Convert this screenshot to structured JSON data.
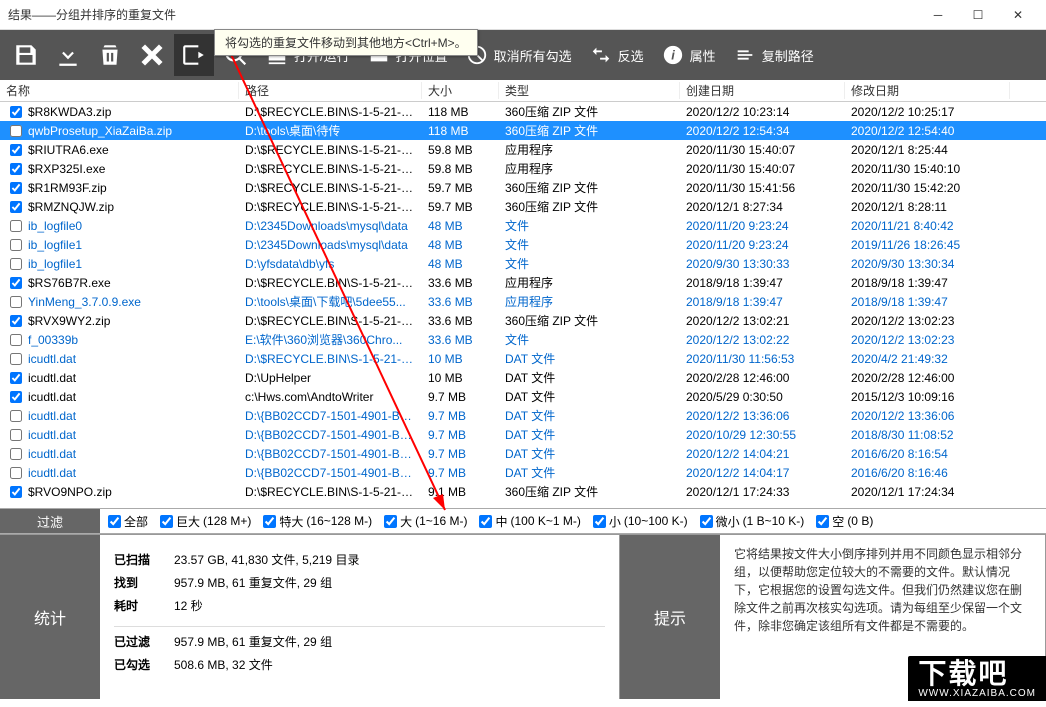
{
  "window": {
    "title": "结果——分组并排序的重复文件"
  },
  "tooltip": {
    "text": "将勾选的重复文件移动到其他地方<Ctrl+M>。"
  },
  "toolbar": {
    "save_icon": "save-icon",
    "download_icon": "download-icon",
    "recycle_icon": "recycle-icon",
    "delete_icon": "close-icon",
    "move_icon": "move-icon",
    "search_icon": "search-icon",
    "open_run": "打开/运行",
    "open_location": "打开位置",
    "uncheck_all": "取消所有勾选",
    "invert": "反选",
    "properties": "属性",
    "copy_path": "复制路径"
  },
  "columns": {
    "name": "名称",
    "path": "路径",
    "size": "大小",
    "type": "类型",
    "cdate": "创建日期",
    "mdate": "修改日期"
  },
  "rows": [
    {
      "chk": true,
      "name": "$R8KWDA3.zip",
      "path": "D:\\$RECYCLE.BIN\\S-1-5-21-21...",
      "size": "118 MB",
      "type": "360压缩 ZIP 文件",
      "cdate": "2020/12/2 10:23:14",
      "mdate": "2020/12/2 10:25:17",
      "link": false,
      "sel": false
    },
    {
      "chk": false,
      "name": "qwbProsetup_XiaZaiBa.zip",
      "path": "D:\\tools\\桌面\\待传",
      "size": "118 MB",
      "type": "360压缩 ZIP 文件",
      "cdate": "2020/12/2 12:54:34",
      "mdate": "2020/12/2 12:54:40",
      "link": false,
      "sel": true
    },
    {
      "chk": true,
      "name": "$RIUTRA6.exe",
      "path": "D:\\$RECYCLE.BIN\\S-1-5-21-21...",
      "size": "59.8 MB",
      "type": "应用程序",
      "cdate": "2020/11/30 15:40:07",
      "mdate": "2020/12/1 8:25:44",
      "link": false,
      "sel": false
    },
    {
      "chk": true,
      "name": "$RXP325I.exe",
      "path": "D:\\$RECYCLE.BIN\\S-1-5-21-21...",
      "size": "59.8 MB",
      "type": "应用程序",
      "cdate": "2020/11/30 15:40:07",
      "mdate": "2020/11/30 15:40:10",
      "link": false,
      "sel": false
    },
    {
      "chk": true,
      "name": "$R1RM93F.zip",
      "path": "D:\\$RECYCLE.BIN\\S-1-5-21-21...",
      "size": "59.7 MB",
      "type": "360压缩 ZIP 文件",
      "cdate": "2020/11/30 15:41:56",
      "mdate": "2020/11/30 15:42:20",
      "link": false,
      "sel": false
    },
    {
      "chk": true,
      "name": "$RMZNQJW.zip",
      "path": "D:\\$RECYCLE.BIN\\S-1-5-21-21...",
      "size": "59.7 MB",
      "type": "360压缩 ZIP 文件",
      "cdate": "2020/12/1 8:27:34",
      "mdate": "2020/12/1 8:28:11",
      "link": false,
      "sel": false
    },
    {
      "chk": false,
      "name": "ib_logfile0",
      "path": "D:\\2345Downloads\\mysql\\data",
      "size": "48 MB",
      "type": "文件",
      "cdate": "2020/11/20 9:23:24",
      "mdate": "2020/11/21 8:40:42",
      "link": true,
      "sel": false
    },
    {
      "chk": false,
      "name": "ib_logfile1",
      "path": "D:\\2345Downloads\\mysql\\data",
      "size": "48 MB",
      "type": "文件",
      "cdate": "2020/11/20 9:23:24",
      "mdate": "2019/11/26 18:26:45",
      "link": true,
      "sel": false
    },
    {
      "chk": false,
      "name": "ib_logfile1",
      "path": "D:\\yfsdata\\db\\yfs",
      "size": "48 MB",
      "type": "文件",
      "cdate": "2020/9/30 13:30:33",
      "mdate": "2020/9/30 13:30:34",
      "link": true,
      "sel": false
    },
    {
      "chk": true,
      "name": "$RS76B7R.exe",
      "path": "D:\\$RECYCLE.BIN\\S-1-5-21-21...",
      "size": "33.6 MB",
      "type": "应用程序",
      "cdate": "2018/9/18 1:39:47",
      "mdate": "2018/9/18 1:39:47",
      "link": false,
      "sel": false
    },
    {
      "chk": false,
      "name": "YinMeng_3.7.0.9.exe",
      "path": "D:\\tools\\桌面\\下载吧\\5dee55...",
      "size": "33.6 MB",
      "type": "应用程序",
      "cdate": "2018/9/18 1:39:47",
      "mdate": "2018/9/18 1:39:47",
      "link": true,
      "sel": false
    },
    {
      "chk": true,
      "name": "$RVX9WY2.zip",
      "path": "D:\\$RECYCLE.BIN\\S-1-5-21-21...",
      "size": "33.6 MB",
      "type": "360压缩 ZIP 文件",
      "cdate": "2020/12/2 13:02:21",
      "mdate": "2020/12/2 13:02:23",
      "link": false,
      "sel": false
    },
    {
      "chk": false,
      "name": "f_00339b",
      "path": "E:\\软件\\360浏览器\\360Chro...",
      "size": "33.6 MB",
      "type": "文件",
      "cdate": "2020/12/2 13:02:22",
      "mdate": "2020/12/2 13:02:23",
      "link": true,
      "sel": false
    },
    {
      "chk": false,
      "name": "icudtl.dat",
      "path": "D:\\$RECYCLE.BIN\\S-1-5-21-21...",
      "size": "10 MB",
      "type": "DAT 文件",
      "cdate": "2020/11/30 11:56:53",
      "mdate": "2020/4/2 21:49:32",
      "link": true,
      "sel": false
    },
    {
      "chk": true,
      "name": "icudtl.dat",
      "path": "D:\\UpHelper",
      "size": "10 MB",
      "type": "DAT 文件",
      "cdate": "2020/2/28 12:46:00",
      "mdate": "2020/2/28 12:46:00",
      "link": false,
      "sel": false
    },
    {
      "chk": true,
      "name": "icudtl.dat",
      "path": "c:\\Hws.com\\AndtoWriter",
      "size": "9.7 MB",
      "type": "DAT 文件",
      "cdate": "2020/5/29 0:30:50",
      "mdate": "2015/12/3 10:09:16",
      "link": false,
      "sel": false
    },
    {
      "chk": false,
      "name": "icudtl.dat",
      "path": "D:\\{BB02CCD7-1501-4901-B5E...",
      "size": "9.7 MB",
      "type": "DAT 文件",
      "cdate": "2020/12/2 13:36:06",
      "mdate": "2020/12/2 13:36:06",
      "link": true,
      "sel": false
    },
    {
      "chk": false,
      "name": "icudtl.dat",
      "path": "D:\\{BB02CCD7-1501-4901-B5E...",
      "size": "9.7 MB",
      "type": "DAT 文件",
      "cdate": "2020/10/29 12:30:55",
      "mdate": "2018/8/30 11:08:52",
      "link": true,
      "sel": false
    },
    {
      "chk": false,
      "name": "icudtl.dat",
      "path": "D:\\{BB02CCD7-1501-4901-B5E...",
      "size": "9.7 MB",
      "type": "DAT 文件",
      "cdate": "2020/12/2 14:04:21",
      "mdate": "2016/6/20 8:16:54",
      "link": true,
      "sel": false
    },
    {
      "chk": false,
      "name": "icudtl.dat",
      "path": "D:\\{BB02CCD7-1501-4901-B5E...",
      "size": "9.7 MB",
      "type": "DAT 文件",
      "cdate": "2020/12/2 14:04:17",
      "mdate": "2016/6/20 8:16:46",
      "link": true,
      "sel": false
    },
    {
      "chk": true,
      "name": "$RVO9NPO.zip",
      "path": "D:\\$RECYCLE.BIN\\S-1-5-21-21...",
      "size": "9.1 MB",
      "type": "360压缩 ZIP 文件",
      "cdate": "2020/12/1 17:24:33",
      "mdate": "2020/12/1 17:24:34",
      "link": false,
      "sel": false
    }
  ],
  "filter": {
    "label": "过滤",
    "all": "全部",
    "huge": "巨大",
    "huge_r": "(128 M+)",
    "large": "特大",
    "large_r": "(16~128 M-)",
    "big": "大",
    "big_r": "(1~16 M-)",
    "med": "中",
    "med_r": "(100 K~1 M-)",
    "small": "小",
    "small_r": "(10~100 K-)",
    "tiny": "微小",
    "tiny_r": "(1 B~10 K-)",
    "empty": "空",
    "empty_r": "(0 B)"
  },
  "stats": {
    "label": "统计",
    "scanned_k": "已扫描",
    "scanned_v": "23.57 GB, 41,830 文件, 5,219 目录",
    "found_k": "找到",
    "found_v": "957.9 MB, 61 重复文件, 29 组",
    "time_k": "耗时",
    "time_v": "12 秒",
    "filtered_k": "已过滤",
    "filtered_v": "957.9 MB, 61 重复文件, 29 组",
    "checked_k": "已勾选",
    "checked_v": "508.6 MB, 32 文件"
  },
  "tips": {
    "label": "提示",
    "text": "它将结果按文件大小倒序排列并用不同颜色显示相邻分组，以便帮助您定位较大的不需要的文件。默认情况下，它根据您的设置勾选文件。但我们仍然建议您在删除文件之前再次核实勾选项。请为每组至少保留一个文件，除非您确定该组所有文件都是不需要的。"
  },
  "watermark": {
    "big": "下载吧",
    "small": "WWW.XIAZAIBA.COM"
  }
}
